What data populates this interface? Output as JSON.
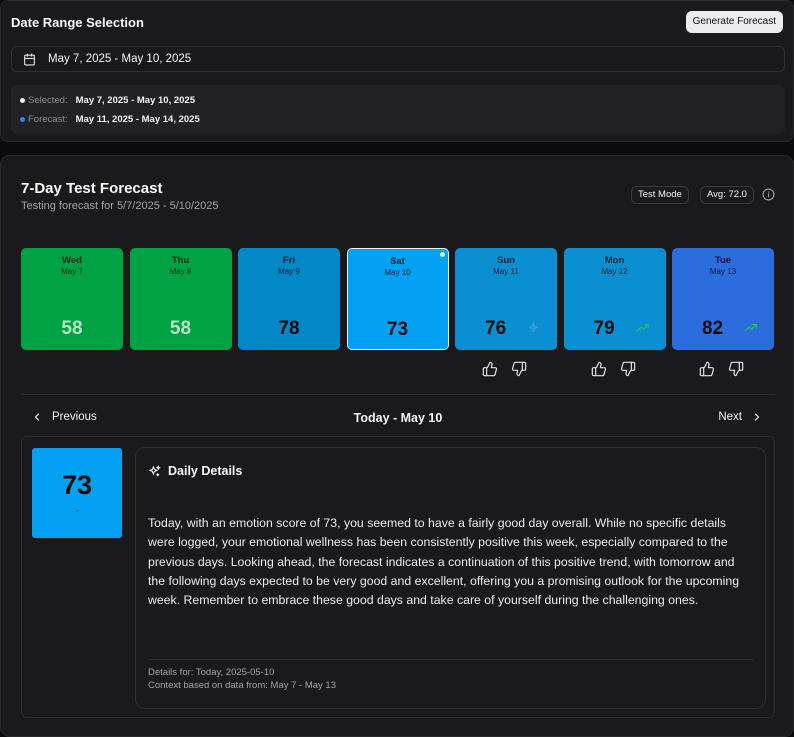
{
  "header": {
    "title": "Date Range Selection",
    "generate_label": "Generate Forecast"
  },
  "date_input": {
    "value": "May 7, 2025 - May 10, 2025",
    "icon": "calendar-icon"
  },
  "legend": {
    "selected_label": "Selected:",
    "selected_value": "May 7, 2025 - May 10, 2025",
    "selected_color": "#f4f4f5",
    "forecast_label": "Forecast:",
    "forecast_value": "May 11, 2025 - May 14, 2025",
    "forecast_color": "#3b82f6"
  },
  "forecast": {
    "title": "7-Day Test Forecast",
    "subtitle": "Testing forecast for 5/7/2025 - 5/10/2025",
    "mode_badge": "Test Mode",
    "avg_badge": "Avg: 72.0",
    "days": [
      {
        "day": "Wed",
        "date": "May 7",
        "score": "58",
        "bg": "#00a343",
        "text": "#0d2e18",
        "score_color": "#b7e4c4",
        "kind": "past"
      },
      {
        "day": "Thu",
        "date": "May 8",
        "score": "58",
        "bg": "#00a343",
        "text": "#0d2e18",
        "score_color": "#b7e4c4",
        "kind": "past"
      },
      {
        "day": "Fri",
        "date": "May 9",
        "score": "78",
        "bg": "#0287c7",
        "text": "#0b1f2e",
        "score_color": "#0b0b0d",
        "kind": "past"
      },
      {
        "day": "Sat",
        "date": "May 10",
        "score": "73",
        "bg": "#03a1f2",
        "text": "#0b1f2e",
        "score_color": "#0b0b0d",
        "kind": "selected"
      },
      {
        "day": "Sun",
        "date": "May 11",
        "score": "76",
        "bg": "#0a90d2",
        "text": "#0b1f2e",
        "score_color": "#0b0b0d",
        "kind": "forecast",
        "trend": "sparkle-icon"
      },
      {
        "day": "Mon",
        "date": "May 12",
        "score": "79",
        "bg": "#0a90d2",
        "text": "#0b1f2e",
        "score_color": "#0b0b0d",
        "kind": "forecast",
        "trend": "trending-up-icon"
      },
      {
        "day": "Tue",
        "date": "May 13",
        "score": "82",
        "bg": "#2b6cdf",
        "text": "#0b1433",
        "score_color": "#0b0b0d",
        "kind": "forecast",
        "trend": "trending-up-icon"
      }
    ]
  },
  "nav": {
    "previous_label": "Previous",
    "today_label": "Today - May 10",
    "next_label": "Next"
  },
  "details": {
    "score": "73",
    "score_sub": "-",
    "heading": "Daily Details",
    "body": "Today, with an emotion score of 73, you seemed to have a fairly good day overall. While no specific details were logged, your emotional wellness has been consistently positive this week, especially compared to the previous days. Looking ahead, the forecast indicates a continuation of this positive trend, with tomorrow and the following days expected to be very good and excellent, offering you a promising outlook for the upcoming week. Remember to embrace these good days and take care of yourself during the challenging ones.",
    "footer_line1": "Details for: Today, 2025-05-10",
    "footer_line2": "Context based on data from: May 7 - May 13"
  }
}
